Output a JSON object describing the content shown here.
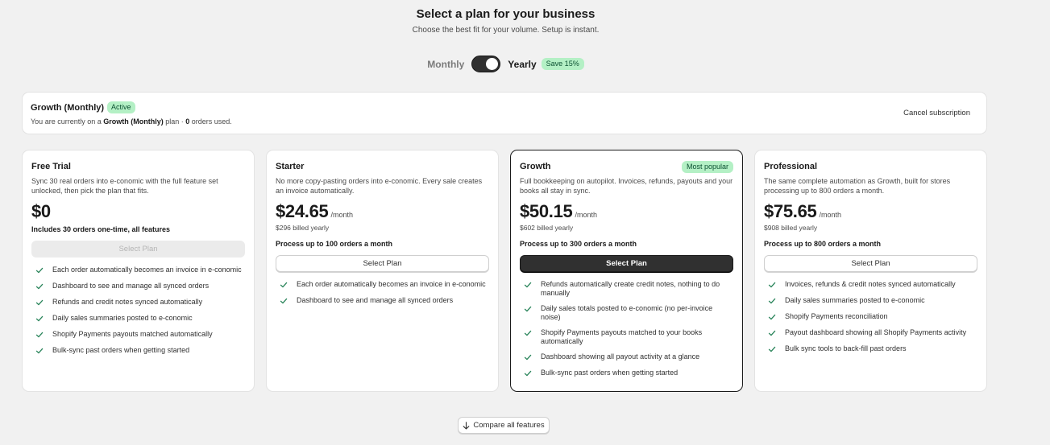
{
  "header": {
    "title": "Select a plan for your business",
    "subtitle": "Choose the best fit for your volume. Setup is instant."
  },
  "billing": {
    "monthly_label": "Monthly",
    "yearly_label": "Yearly",
    "save_badge": "Save 15%",
    "selected": "yearly"
  },
  "current_plan": {
    "title": "Growth (Monthly)",
    "status_badge": "Active",
    "desc_prefix": "You are currently on a ",
    "desc_plan": "Growth (Monthly)",
    "desc_mid": " plan · ",
    "desc_orders": "0",
    "desc_suffix": " orders used.",
    "cancel_label": "Cancel subscription"
  },
  "plans": [
    {
      "name": "Free Trial",
      "description": "Sync 30 real orders into e-conomic with the full feature set unlocked, then pick the plan that fits.",
      "price": "$0",
      "per": "",
      "billed": "",
      "limit": "Includes 30 orders one-time, all features",
      "button": "Select Plan",
      "features": [
        "Each order automatically becomes an invoice in e-conomic",
        "Dashboard to see and manage all synced orders",
        "Refunds and credit notes synced automatically",
        "Daily sales summaries posted to e-conomic",
        "Shopify Payments payouts matched automatically",
        "Bulk-sync past orders when getting started"
      ]
    },
    {
      "name": "Starter",
      "description": "No more copy-pasting orders into e-conomic. Every sale creates an invoice automatically.",
      "price": "$24.65",
      "per": "/month",
      "billed": "$296 billed yearly",
      "limit": "Process up to 100 orders a month",
      "button": "Select Plan",
      "features": [
        "Each order automatically becomes an invoice in e-conomic",
        "Dashboard to see and manage all synced orders"
      ]
    },
    {
      "name": "Growth",
      "badge": "Most popular",
      "description": "Full bookkeeping on autopilot. Invoices, refunds, payouts and your books all stay in sync.",
      "price": "$50.15",
      "per": "/month",
      "billed": "$602 billed yearly",
      "limit": "Process up to 300 orders a month",
      "button": "Select Plan",
      "features": [
        "Refunds automatically create credit notes, nothing to do manually",
        "Daily sales totals posted to e-conomic (no per-invoice noise)",
        "Shopify Payments payouts matched to your books automatically",
        "Dashboard showing all payout activity at a glance",
        "Bulk-sync past orders when getting started"
      ]
    },
    {
      "name": "Professional",
      "description": "The same complete automation as Growth, built for stores processing up to 800 orders a month.",
      "price": "$75.65",
      "per": "/month",
      "billed": "$908 billed yearly",
      "limit": "Process up to 800 orders a month",
      "button": "Select Plan",
      "features": [
        "Invoices, refunds & credit notes synced automatically",
        "Daily sales summaries posted to e-conomic",
        "Shopify Payments reconciliation",
        "Payout dashboard showing all Shopify Payments activity",
        "Bulk sync tools to back-fill past orders"
      ]
    }
  ],
  "compare_label": "Compare all features",
  "colors": {
    "accent_dark": "#303030",
    "badge_green_bg": "#b4f0c5",
    "badge_green_text": "#0c5132",
    "check_green": "#29845a"
  }
}
